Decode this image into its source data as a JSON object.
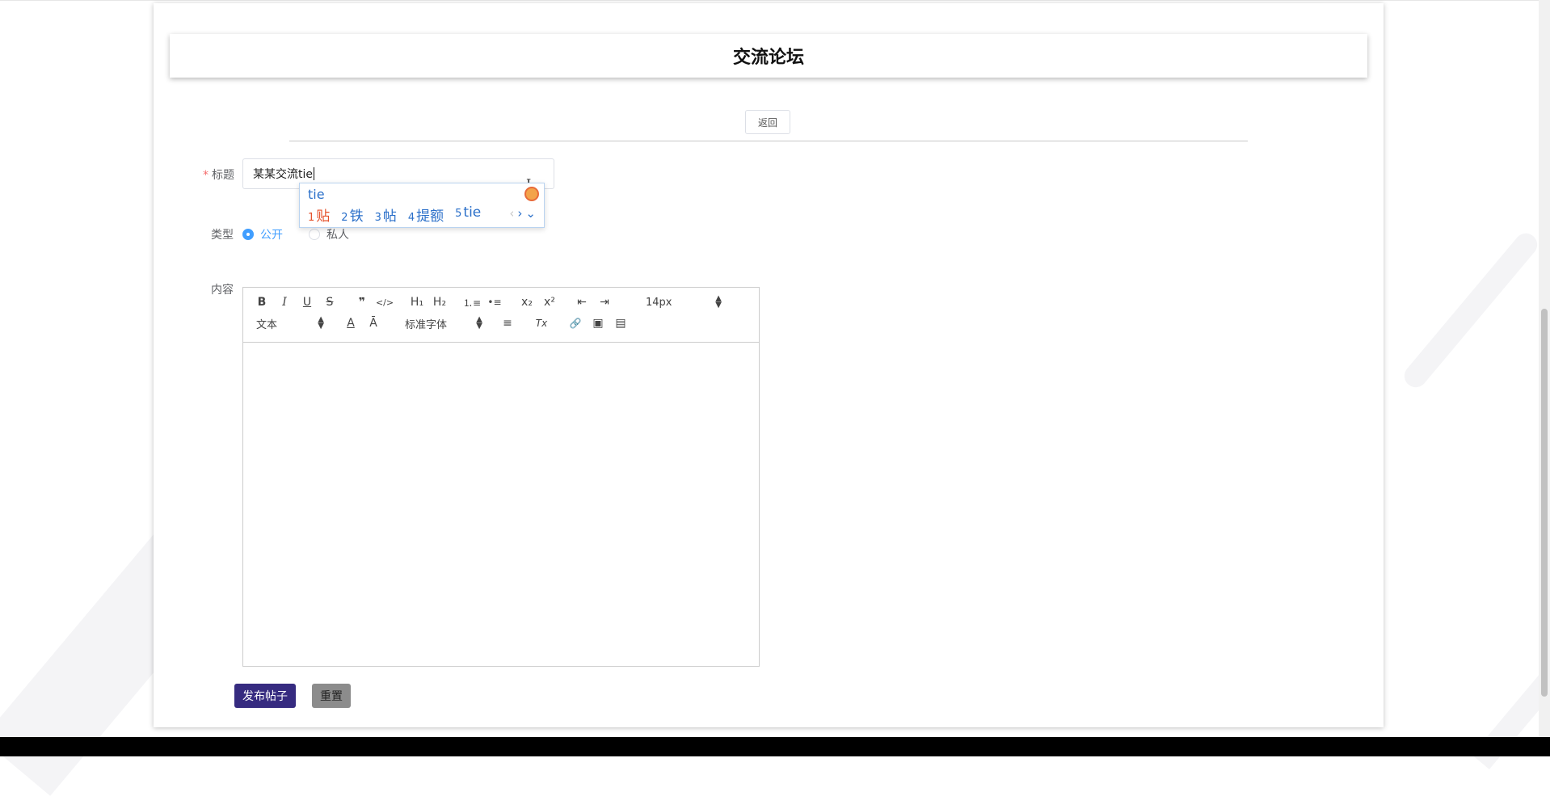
{
  "header": {
    "title": "交流论坛"
  },
  "toolbar": {
    "back_label": "返回"
  },
  "form": {
    "title_label": "标题",
    "required_mark": "*",
    "title_value": "某某交流tie",
    "type_label": "类型",
    "type_options": [
      {
        "label": "公开",
        "selected": true
      },
      {
        "label": "私人",
        "selected": false
      }
    ],
    "content_label": "内容"
  },
  "ime": {
    "composition": "tie",
    "candidates": [
      {
        "num": "1",
        "text": "贴"
      },
      {
        "num": "2",
        "text": "铁"
      },
      {
        "num": "3",
        "text": "帖"
      },
      {
        "num": "4",
        "text": "提额"
      },
      {
        "num": "5",
        "text": "tie"
      }
    ],
    "nav": {
      "prev": "‹",
      "next": "›",
      "expand": "⌄"
    }
  },
  "editor": {
    "toolbar_row1": [
      {
        "name": "bold-button",
        "glyph": "B"
      },
      {
        "name": "italic-button",
        "glyph": "I"
      },
      {
        "name": "underline-button",
        "glyph": "U"
      },
      {
        "name": "strike-button",
        "glyph": "S"
      },
      {
        "name": "blockquote-button",
        "glyph": "❞"
      },
      {
        "name": "code-block-button",
        "glyph": "</>"
      },
      {
        "name": "header1-button",
        "glyph": "H₁"
      },
      {
        "name": "header2-button",
        "glyph": "H₂"
      },
      {
        "name": "ordered-list-button",
        "glyph": "⒈≡"
      },
      {
        "name": "bullet-list-button",
        "glyph": "•≡"
      },
      {
        "name": "subscript-button",
        "glyph": "x₂"
      },
      {
        "name": "superscript-button",
        "glyph": "x²"
      },
      {
        "name": "outdent-button",
        "glyph": "⇤"
      },
      {
        "name": "indent-button",
        "glyph": "⇥"
      }
    ],
    "font_size": "14px",
    "paragraph_style": "文本",
    "font_family": "标准字体",
    "toolbar_row2": [
      {
        "name": "text-color-button",
        "glyph": "A"
      },
      {
        "name": "background-color-button",
        "glyph": "Ā"
      },
      {
        "name": "align-button",
        "glyph": "≡"
      },
      {
        "name": "clean-format-button",
        "glyph": "Tx"
      },
      {
        "name": "link-button",
        "glyph": "🔗"
      },
      {
        "name": "image-button",
        "glyph": "▣"
      },
      {
        "name": "video-button",
        "glyph": "▤"
      }
    ],
    "body_text": ""
  },
  "actions": {
    "publish_label": "发布帖子",
    "reset_label": "重置"
  },
  "colors": {
    "accent": "#409eff",
    "publish_bg": "#362b80",
    "reset_bg": "#8c8c8c"
  }
}
